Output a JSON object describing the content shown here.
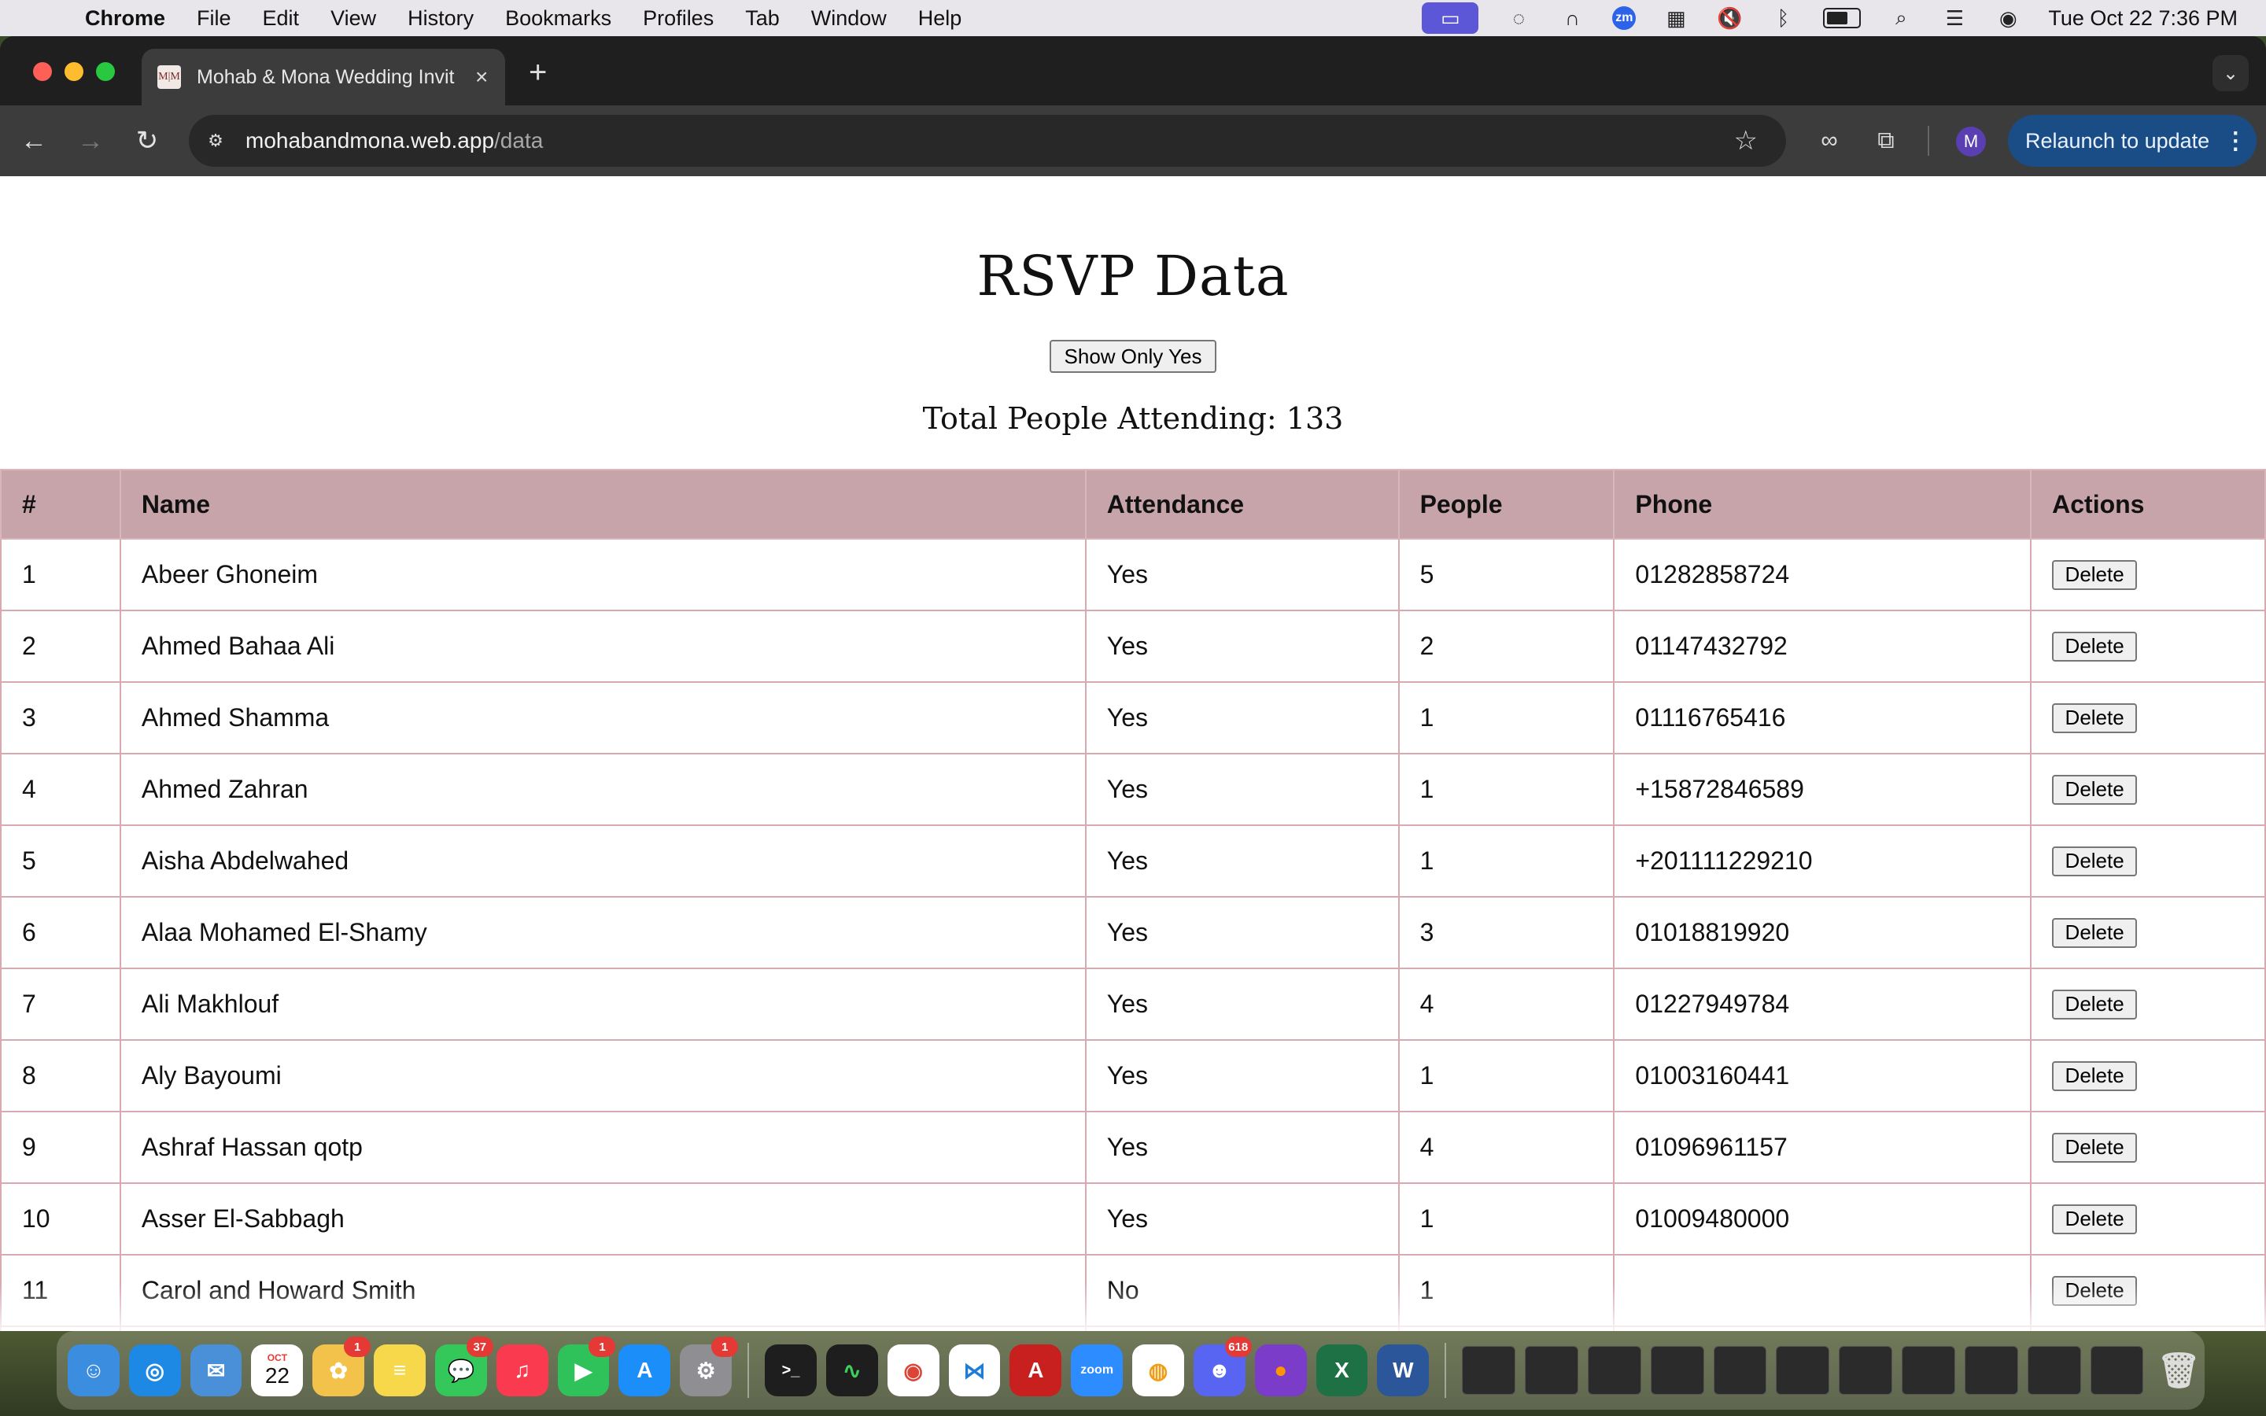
{
  "menubar": {
    "app_name": "Chrome",
    "items": [
      "File",
      "Edit",
      "View",
      "History",
      "Bookmarks",
      "Profiles",
      "Tab",
      "Window",
      "Help"
    ],
    "clock": "Tue Oct 22  7:36 PM",
    "zoom_label": "zm"
  },
  "browser": {
    "tab_title": "Mohab & Mona Wedding Invit",
    "favicon_text": "M|M",
    "url_host": "mohabandmona.web.app",
    "url_path": "/data",
    "profile_initial": "M",
    "relaunch_label": "Relaunch to update"
  },
  "page": {
    "title": "RSVP Data",
    "filter_button": "Show Only Yes",
    "total_label": "Total People Attending: 133",
    "columns": [
      "#",
      "Name",
      "Attendance",
      "People",
      "Phone",
      "Actions"
    ],
    "delete_label": "Delete",
    "rows": [
      {
        "n": "1",
        "name": "Abeer Ghoneim",
        "attendance": "Yes",
        "people": "5",
        "phone": "01282858724"
      },
      {
        "n": "2",
        "name": "Ahmed Bahaa Ali",
        "attendance": "Yes",
        "people": "2",
        "phone": "01147432792"
      },
      {
        "n": "3",
        "name": "Ahmed Shamma",
        "attendance": "Yes",
        "people": "1",
        "phone": "01116765416"
      },
      {
        "n": "4",
        "name": "Ahmed Zahran",
        "attendance": "Yes",
        "people": "1",
        "phone": "+15872846589"
      },
      {
        "n": "5",
        "name": "Aisha Abdelwahed",
        "attendance": "Yes",
        "people": "1",
        "phone": "+201111229210"
      },
      {
        "n": "6",
        "name": "Alaa Mohamed El-Shamy",
        "attendance": "Yes",
        "people": "3",
        "phone": "01018819920"
      },
      {
        "n": "7",
        "name": "Ali Makhlouf",
        "attendance": "Yes",
        "people": "4",
        "phone": "01227949784"
      },
      {
        "n": "8",
        "name": "Aly Bayoumi",
        "attendance": "Yes",
        "people": "1",
        "phone": "01003160441"
      },
      {
        "n": "9",
        "name": "Ashraf Hassan qotp",
        "attendance": "Yes",
        "people": "4",
        "phone": "01096961157"
      },
      {
        "n": "10",
        "name": "Asser El-Sabbagh",
        "attendance": "Yes",
        "people": "1",
        "phone": "01009480000"
      },
      {
        "n": "11",
        "name": "Carol and Howard Smith",
        "attendance": "No",
        "people": "1",
        "phone": ""
      }
    ]
  },
  "dock": {
    "calendar_month": "OCT",
    "calendar_day": "22",
    "apps": [
      {
        "name": "Finder",
        "icon": "finder-icon",
        "color": "#3b8de0"
      },
      {
        "name": "Safari",
        "icon": "safari-icon",
        "color": "#1e88e5"
      },
      {
        "name": "Mail",
        "icon": "mail-icon",
        "color": "#4a90d9"
      },
      {
        "name": "Calendar",
        "icon": "calendar-icon",
        "color": "#ffffff"
      },
      {
        "name": "Photos",
        "icon": "photos-icon",
        "color": "#f3c24a",
        "badge": "1"
      },
      {
        "name": "Notes",
        "icon": "notes-icon",
        "color": "#f7d84a"
      },
      {
        "name": "Messages",
        "icon": "messages-icon",
        "color": "#34c759",
        "badge": "37"
      },
      {
        "name": "Music",
        "icon": "music-icon",
        "color": "#fa3b4f"
      },
      {
        "name": "FaceTime",
        "icon": "facetime-icon",
        "color": "#30c25a",
        "badge": "1"
      },
      {
        "name": "App Store",
        "icon": "appstore-icon",
        "color": "#1c8ef9"
      },
      {
        "name": "System Settings",
        "icon": "settings-icon",
        "color": "#8e8e93",
        "badge": "1"
      },
      {
        "name": "Terminal",
        "icon": "terminal-icon",
        "color": "#1e1e1e"
      },
      {
        "name": "Activity Monitor",
        "icon": "activity-icon",
        "color": "#1e1e1e"
      },
      {
        "name": "Chrome",
        "icon": "chrome-icon",
        "color": "#ffffff"
      },
      {
        "name": "VS Code",
        "icon": "vscode-icon",
        "color": "#ffffff"
      },
      {
        "name": "Acrobat",
        "icon": "acrobat-icon",
        "color": "#c8201e"
      },
      {
        "name": "Zoom",
        "icon": "zoom-icon",
        "color": "#2d8cff"
      },
      {
        "name": "Podcasts",
        "icon": "podcast-icon",
        "color": "#ffffff"
      },
      {
        "name": "Discord",
        "icon": "discord-icon",
        "color": "#5865f2",
        "badge": "618"
      },
      {
        "name": "Firefox",
        "icon": "firefox-icon",
        "color": "#7a3cc9"
      },
      {
        "name": "Excel",
        "icon": "excel-icon",
        "color": "#1e7145"
      },
      {
        "name": "Word",
        "icon": "word-icon",
        "color": "#2b579a"
      }
    ]
  }
}
